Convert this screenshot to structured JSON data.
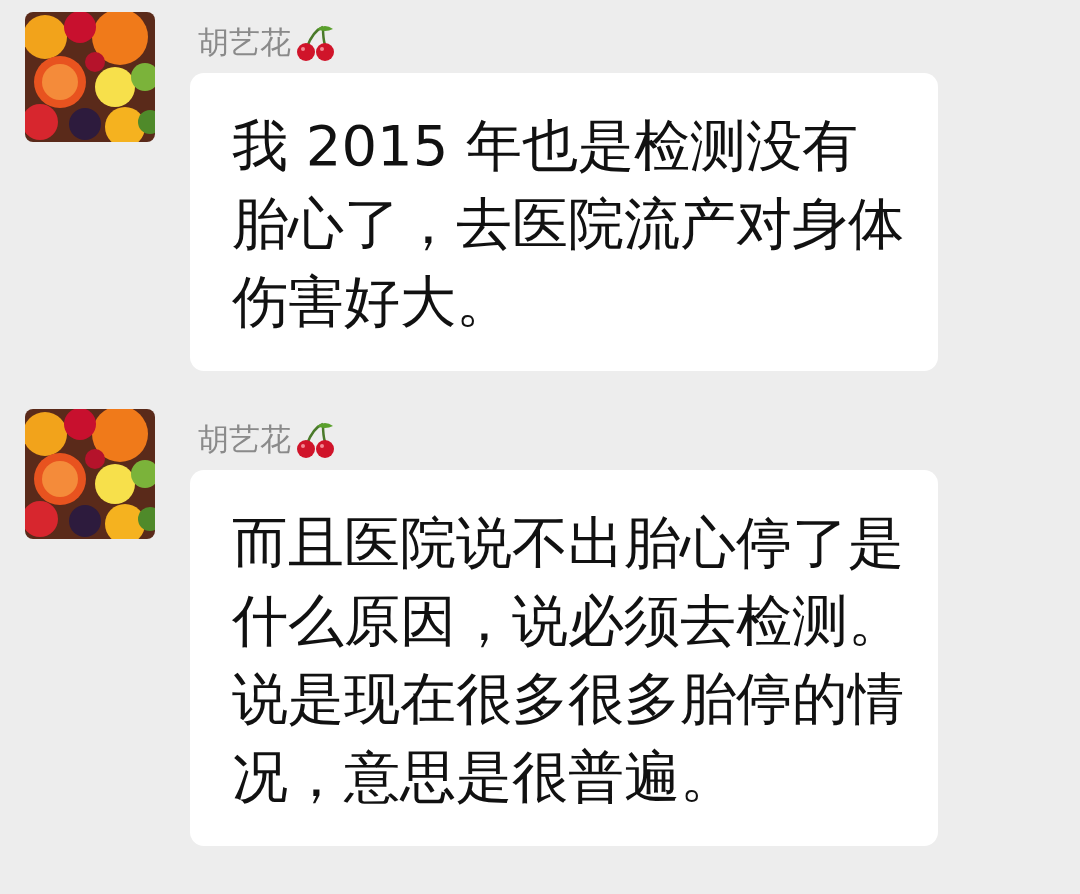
{
  "messages": [
    {
      "sender": "胡艺花",
      "text": "我 2015 年也是检测没有胎心了，去医院流产对身体伤害好大。"
    },
    {
      "sender": "胡艺花",
      "text": "而且医院说不出胎心停了是什么原因，说必须去检测。说是现在很多很多胎停的情况，意思是很普遍。"
    }
  ]
}
